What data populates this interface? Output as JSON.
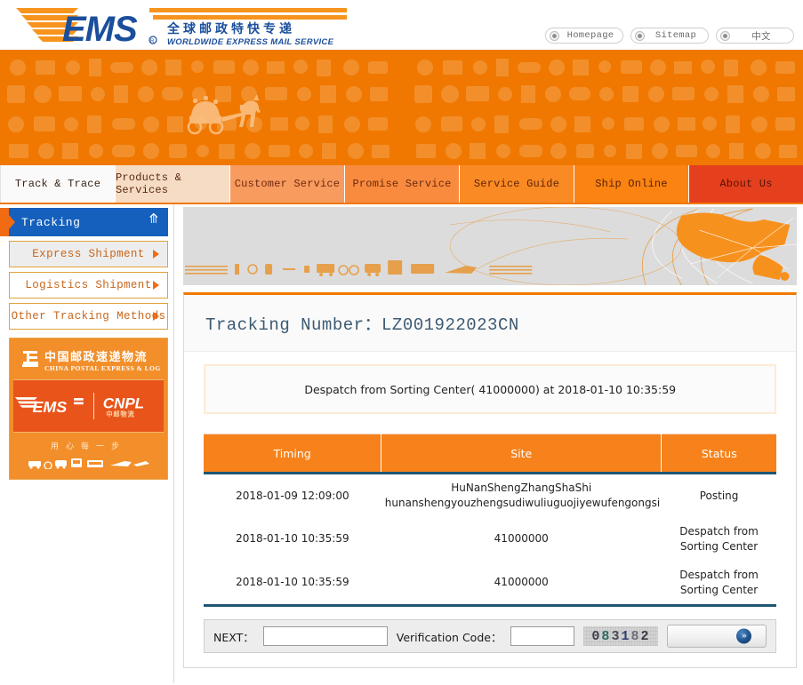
{
  "header": {
    "logo_text": "EMS",
    "logo_tagline_cn": "全 球 邮 政 特 快 专 递",
    "logo_tagline_en": "WORLDWIDE EXPRESS MAIL SERVICE",
    "top_links": [
      {
        "label": "Homepage",
        "icon": "circle-bullet-icon"
      },
      {
        "label": "Sitemap",
        "icon": "circle-bullet-icon"
      },
      {
        "label": "中文",
        "icon": "circle-bullet-icon"
      }
    ]
  },
  "nav": {
    "tabs": [
      {
        "label": "Track & Trace",
        "active": true
      },
      {
        "label": "Products & Services",
        "active": false
      },
      {
        "label": "Customer Service",
        "active": false
      },
      {
        "label": "Promise Service",
        "active": false
      },
      {
        "label": "Service Guide",
        "active": false
      },
      {
        "label": "Ship Online",
        "active": false
      },
      {
        "label": "About Us",
        "active": false
      }
    ]
  },
  "sidebar": {
    "section_title": "Tracking",
    "collapse_icon": "chevron-double-up-icon",
    "items": [
      {
        "label": "Express Shipment"
      },
      {
        "label": "Logistics Shipment"
      },
      {
        "label": "Other Tracking Methods"
      }
    ],
    "promo": {
      "china_post_cn": "中国邮政速递物流",
      "china_post_en": "CHINA POSTAL EXPRESS & LOGISTICS",
      "brand_left": "EMS",
      "brand_right": "CNPL",
      "brand_right_cn": "中邮物流",
      "slogan": "用心每一步"
    }
  },
  "content": {
    "panel_title": "Tracking Number：LZ001922023CN",
    "notice": "Despatch from Sorting Center( 41000000) at 2018-01-10 10:35:59",
    "table": {
      "columns": [
        "Timing",
        "Site",
        "Status"
      ],
      "rows": [
        {
          "timing": "2018-01-09  12:09:00",
          "site_line1": "HuNanShengZhangShaShi",
          "site_line2": "hunanshengyouzhengsudiwuliuguojiyewufengongsi",
          "status_line1": "Posting",
          "status_line2": ""
        },
        {
          "timing": "2018-01-10  10:35:59",
          "site_line1": "41000000",
          "site_line2": "",
          "status_line1": "Despatch from",
          "status_line2": "Sorting Center"
        },
        {
          "timing": "2018-01-10  10:35:59",
          "site_line1": "41000000",
          "site_line2": "",
          "status_line1": "Despatch from",
          "status_line2": "Sorting Center"
        }
      ]
    },
    "form": {
      "next_label": "NEXT：",
      "next_value": "",
      "verification_label": "Verification Code：",
      "verification_value": "",
      "captcha_text": "083182",
      "submit_icon": "double-chevron-right-icon"
    }
  },
  "colors": {
    "brand_orange": "#F07800",
    "table_header_orange": "#F7821B",
    "sidebar_blue": "#1560BD",
    "about_us_red": "#E5401E",
    "title_blue_gray": "#3C5A73"
  }
}
